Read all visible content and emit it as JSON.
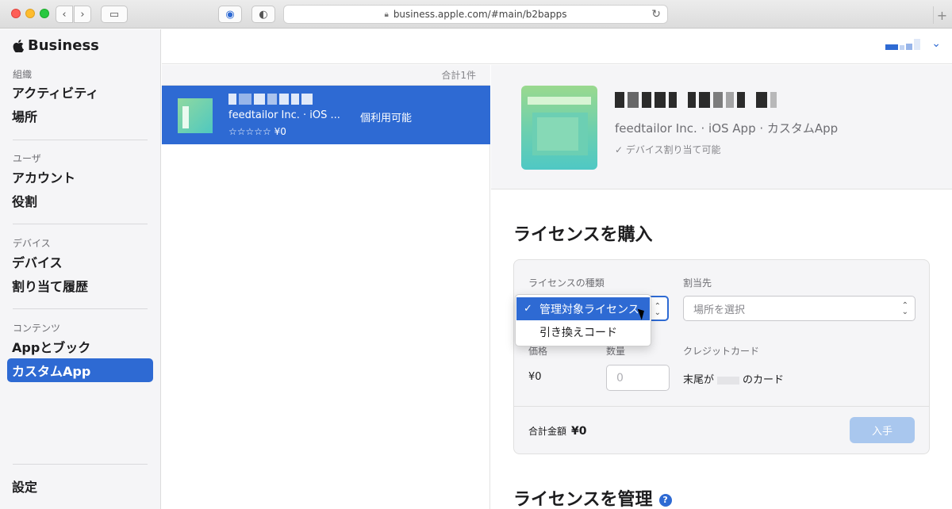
{
  "browser": {
    "url": "business.apple.com/#main/b2bapps",
    "icons": [
      "back-icon",
      "forward-icon",
      "sidebar-icon",
      "password-icon",
      "shield-icon",
      "lock-icon",
      "reload-icon",
      "plus-icon"
    ]
  },
  "sidebar": {
    "brand": "Business",
    "sections": [
      {
        "label": "組織",
        "items": [
          "アクティビティ",
          "場所"
        ]
      },
      {
        "label": "ユーザ",
        "items": [
          "アカウント",
          "役割"
        ]
      },
      {
        "label": "デバイス",
        "items": [
          "デバイス",
          "割り当て履歴"
        ]
      },
      {
        "label": "コンテンツ",
        "items": [
          "Appとブック",
          "カスタムApp"
        ]
      }
    ],
    "active_item": "カスタムApp",
    "settings": "設定"
  },
  "list": {
    "total": "合計1件",
    "row": {
      "subtitle": "feedtailor Inc. · iOS ...",
      "availability": "個利用可能",
      "rating": "☆☆☆☆☆ ¥0"
    }
  },
  "detail": {
    "subtitle": "feedtailor Inc. · iOS App · カスタムApp",
    "assign_note": "デバイス割り当て可能",
    "purchase_title": "ライセンスを購入",
    "manage_title": "ライセンスを管理",
    "help": "?",
    "form": {
      "license_type_label": "ライセンスの種類",
      "assign_label": "割当先",
      "assign_placeholder": "場所を選択",
      "price_label": "価格",
      "price_value": "¥0",
      "qty_label": "数量",
      "qty_placeholder": "0",
      "card_label": "クレジットカード",
      "card_prefix": "末尾が",
      "card_suffix": "のカード",
      "total_label": "合計金額",
      "total_value": "¥0",
      "get_button": "入手"
    },
    "dropdown": {
      "options": [
        "管理対象ライセンス",
        "引き換えコード"
      ],
      "selected": "管理対象ライセンス",
      "check": "✓"
    }
  },
  "colors": {
    "accent": "#2e6ad3",
    "sidebar_bg": "#f5f5f7",
    "button_disabled": "#a9c7ee"
  }
}
